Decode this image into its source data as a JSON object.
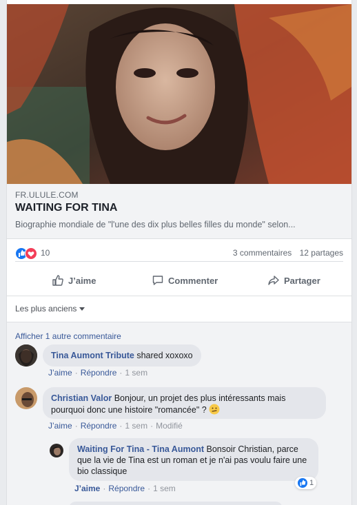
{
  "link": {
    "domain": "FR.ULULE.COM",
    "title": "WAITING FOR TINA",
    "description": "Biographie mondiale de \"l'une des dix plus belles filles du monde\" selon..."
  },
  "stats": {
    "reaction_count": "10",
    "comments": "3 commentaires",
    "shares": "12 partages"
  },
  "actions": {
    "like": "J’aime",
    "comment": "Commenter",
    "share": "Partager"
  },
  "sort": {
    "label": "Les plus anciens"
  },
  "comments_section": {
    "show_more": "Afficher 1 autre commentaire"
  },
  "comments": [
    {
      "author": "Tina Aumont Tribute",
      "text": " shared xoxoxo",
      "like": "J’aime",
      "reply": "Répondre",
      "time": "1 sem"
    },
    {
      "author": "Christian Valor",
      "text": " Bonjour, un projet des plus intéressants mais pourquoi donc une histoire \"romancée\" ? ",
      "like": "J’aime",
      "reply": "Répondre",
      "time": "1 sem",
      "edited": "Modifié"
    },
    {
      "author": "Waiting For Tina - Tina Aumont",
      "text": " Bonsoir Christian, parce que la vie de Tina est un roman et je n'ai pas voulu faire une bio classique",
      "like": "J’aime",
      "reply": "Répondre",
      "time": "1 sem",
      "like_count": "1"
    }
  ],
  "colors": {
    "facebook_blue": "#385898",
    "like_blue": "#1877f2",
    "love_red": "#f33e58",
    "bubble": "#e4e6eb"
  }
}
